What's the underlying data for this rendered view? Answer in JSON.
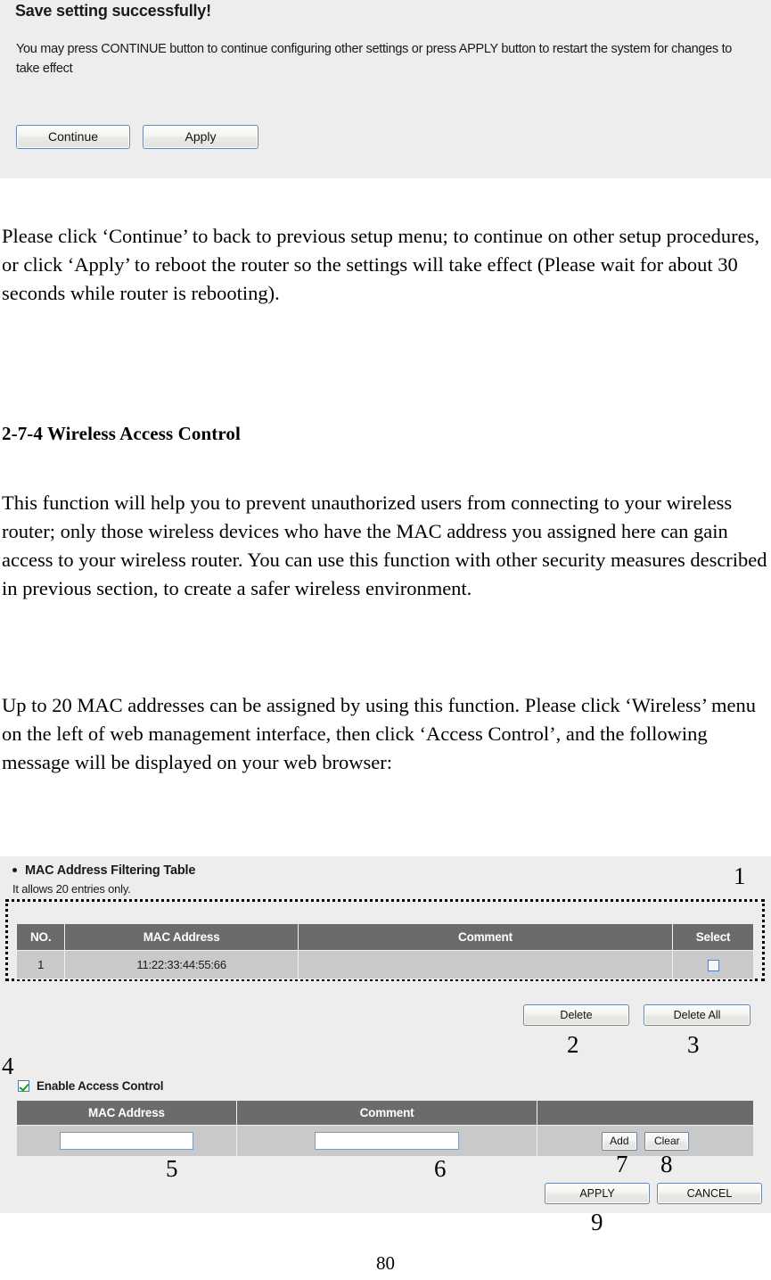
{
  "save_panel": {
    "title": "Save setting successfully!",
    "message": "You may press CONTINUE button to continue configuring other settings or press APPLY button to restart the system for changes to take effect",
    "continue_label": "Continue",
    "apply_label": "Apply"
  },
  "document": {
    "paragraph_1": "Please click ‘Continue’ to back to previous setup menu; to continue on other setup procedures, or click ‘Apply’ to reboot the router so the settings will take effect (Please wait for about 30 seconds while router is rebooting).",
    "heading": "2-7-4 Wireless Access Control",
    "paragraph_2": "This function will help you to prevent unauthorized users from connecting to your wireless router; only those wireless devices who have the MAC address you assigned here can gain access to your wireless router. You can use this function with other security measures described in previous section, to create a safer wireless environment.",
    "paragraph_3": "Up to 20 MAC addresses can be assigned by using this function. Please click ‘Wireless’ menu on the left of web management interface, then click ‘Access Control’, and the following message will be displayed on your web browser:",
    "page_number": "80"
  },
  "access_control": {
    "section_title": "MAC Address Filtering Table",
    "section_note": "It allows 20 entries only.",
    "filter_table": {
      "headers": [
        "NO.",
        "MAC Address",
        "Comment",
        "Select"
      ],
      "rows": [
        {
          "no": "1",
          "mac": "11:22:33:44:55:66",
          "comment": "",
          "selected": false
        }
      ]
    },
    "delete_label": "Delete",
    "delete_all_label": "Delete All",
    "enable_label": "Enable Access Control",
    "enable_checked": true,
    "add_table": {
      "headers": [
        "MAC Address",
        "Comment",
        ""
      ],
      "mac_value": "",
      "mac_placeholder": "",
      "comment_value": "",
      "comment_placeholder": "",
      "add_label": "Add",
      "clear_label": "Clear"
    },
    "apply_label": "APPLY",
    "cancel_label": "CANCEL"
  },
  "callouts": {
    "c1": "1",
    "c2": "2",
    "c3": "3",
    "c4": "4",
    "c5": "5",
    "c6": "6",
    "c7": "7",
    "c8": "8",
    "c9": "9"
  },
  "colors": {
    "panel_bg": "#ededed",
    "table_header_bg": "#6b6b6b",
    "table_row_bg": "#c9c9c9",
    "button_border": "#6b86a8",
    "check_green": "#1c9c1c"
  }
}
